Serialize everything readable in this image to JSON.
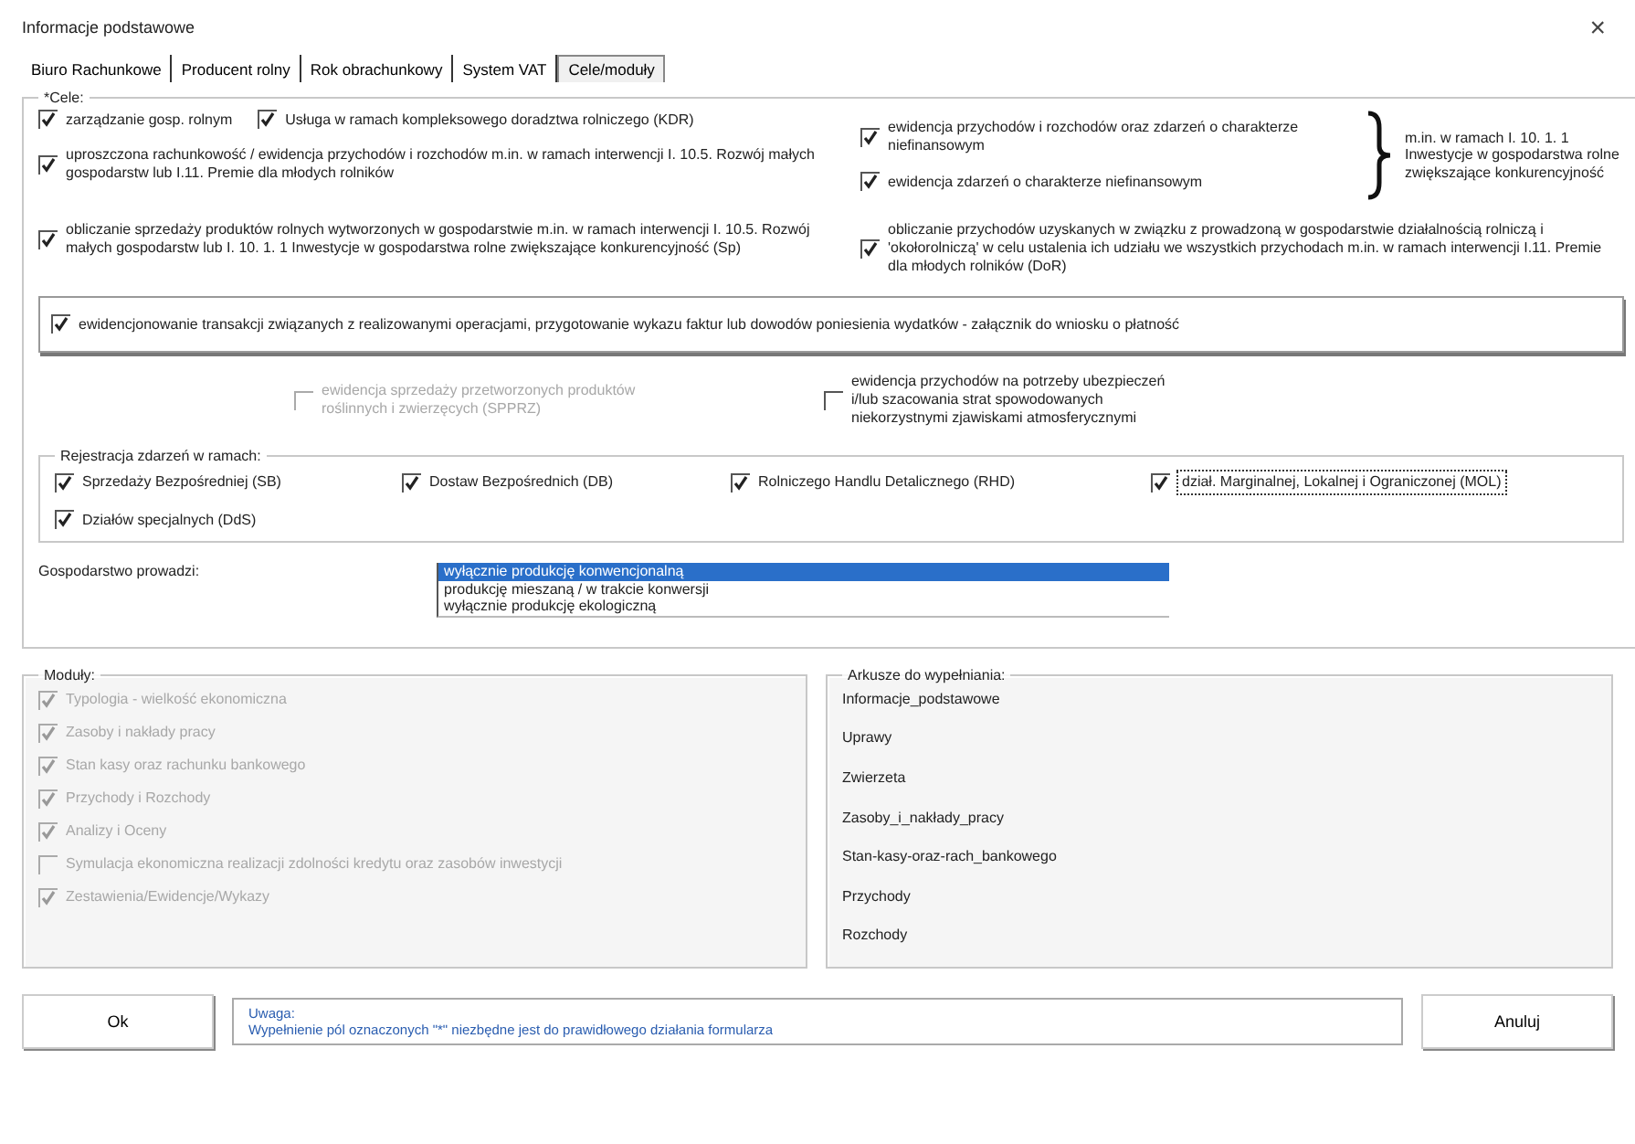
{
  "window": {
    "title": "Informacje podstawowe",
    "close": "×"
  },
  "tabs": [
    {
      "label": "Biuro Rachunkowe",
      "selected": false
    },
    {
      "label": "Producent rolny",
      "selected": false
    },
    {
      "label": "Rok obrachunkowy",
      "selected": false
    },
    {
      "label": "System VAT",
      "selected": false
    },
    {
      "label": "Cele/moduły",
      "selected": true
    }
  ],
  "goals": {
    "legend": "*Cele:",
    "top_left": [
      {
        "label": "zarządzanie gosp. rolnym",
        "checked": true
      },
      {
        "label": "Usługa w ramach kompleksowego doradztwa rolniczego (KDR)",
        "checked": true
      }
    ],
    "simplified": {
      "label": "uproszczona rachunkowość / ewidencja przychodów i rozchodów m.in. w ramach interwencji I. 10.5. Rozwój małych gospodarstw lub I.11. Premie dla młodych rolników",
      "checked": true
    },
    "bracket_items": [
      {
        "label": "ewidencja przychodów i rozchodów oraz zdarzeń o charakterze niefinansowym",
        "checked": true
      },
      {
        "label": "ewidencja zdarzeń o charakterze niefinansowym",
        "checked": true
      }
    ],
    "bracket_note": "m.in. w ramach I. 10. 1. 1 Inwestycje w gospodarstwa rolne zwiększające konkurencyjność",
    "sales": {
      "label": "obliczanie sprzedaży produktów rolnych wytworzonych w gospodarstwie m.in. w ramach interwencji I. 10.5. Rozwój małych gospodarstw lub I. 10. 1. 1 Inwestycje w gospodarstwa rolne zwiększające konkurencyjność (Sp)",
      "checked": true
    },
    "income": {
      "label": "obliczanie przychodów uzyskanych w związku z prowadzoną w gospodarstwie działalnością rolniczą i 'okołorolniczą' w celu ustalenia ich udziału we wszystkich przychodach m.in. w ramach interwencji I.11. Premie dla młodych rolników (DoR)",
      "checked": true
    },
    "transactions": {
      "label": "ewidencjonowanie transakcji związanych z realizowanymi operacjami, przygotowanie wykazu faktur lub dowodów poniesienia wydatków - załącznik do wniosku o płatność",
      "checked": true
    },
    "extras": [
      {
        "label": "ewidencja sprzedaży przetworzonych produktów roślinnych i zwierzęcych (SPPRZ)",
        "checked": false,
        "disabled": true
      },
      {
        "label": "ewidencja przychodów na potrzeby ubezpieczeń i/lub szacowania strat spowodowanych niekorzystnymi zjawiskami atmosferycznymi",
        "checked": false,
        "disabled": false
      }
    ],
    "registration": {
      "legend": "Rejestracja zdarzeń w ramach:",
      "items": [
        {
          "label": "Sprzedaży Bezpośredniej (SB)",
          "checked": true,
          "focused": false
        },
        {
          "label": "Dostaw Bezpośrednich (DB)",
          "checked": true,
          "focused": false
        },
        {
          "label": "Rolniczego Handlu Detalicznego (RHD)",
          "checked": true,
          "focused": false
        },
        {
          "label": "dział. Marginalnej, Lokalnej i Ograniczonej (MOL)",
          "checked": true,
          "focused": true
        },
        {
          "label": "Działów specjalnych (DdS)",
          "checked": true,
          "focused": false
        }
      ]
    },
    "farming": {
      "label": "Gospodarstwo prowadzi:",
      "options": [
        {
          "label": "wyłącznie produkcję konwencjonalną",
          "selected": true
        },
        {
          "label": "produkcję mieszaną / w trakcie konwersji",
          "selected": false
        },
        {
          "label": "wyłącznie produkcję ekologiczną",
          "selected": false
        }
      ]
    }
  },
  "modules": {
    "legend": "Moduły:",
    "items": [
      {
        "label": "Typologia - wielkość ekonomiczna",
        "checked": true,
        "disabled": true
      },
      {
        "label": "Zasoby i nakłady pracy",
        "checked": true,
        "disabled": true
      },
      {
        "label": "Stan kasy oraz rachunku bankowego",
        "checked": true,
        "disabled": true
      },
      {
        "label": "Przychody i Rozchody",
        "checked": true,
        "disabled": true
      },
      {
        "label": "Analizy i Oceny",
        "checked": true,
        "disabled": true
      },
      {
        "label": "Symulacja ekonomiczna realizacji zdolności kredytu oraz zasobów inwestycji",
        "checked": false,
        "disabled": true
      },
      {
        "label": "Zestawienia/Ewidencje/Wykazy",
        "checked": true,
        "disabled": true
      }
    ]
  },
  "sheets": {
    "legend": "Arkusze do wypełniania:",
    "items": [
      "Informacje_podstawowe",
      "Uprawy",
      "Zwierzeta",
      "Zasoby_i_nakłady_pracy",
      "Stan-kasy-oraz-rach_bankowego",
      "Przychody",
      "Rozchody"
    ]
  },
  "footer": {
    "ok": "Ok",
    "note_title": "Uwaga:",
    "note_text": "Wypełnienie pól oznaczonych \"*\" niezbędne jest do prawidłowego działania formularza",
    "cancel": "Anuluj"
  }
}
